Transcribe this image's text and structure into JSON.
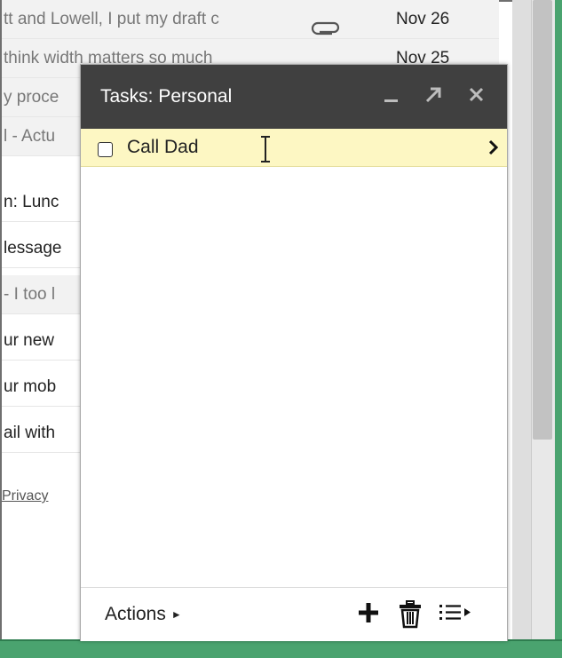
{
  "inbox": {
    "rows": [
      {
        "text": "tt and Lowell, I put my draft c",
        "date": "Nov 26",
        "attachment": true,
        "style": "read"
      },
      {
        "text": "think width matters so much",
        "date": "Nov 25",
        "attachment": false,
        "style": "read"
      },
      {
        "text": "y proce",
        "date": "",
        "attachment": false,
        "style": "read"
      },
      {
        "text": "l - Actu",
        "date": "",
        "attachment": false,
        "style": "read"
      },
      {
        "text": "n: Lunc",
        "date": "",
        "attachment": false,
        "style": "unread"
      },
      {
        "text": "lessage",
        "date": "",
        "attachment": false,
        "style": "unread"
      },
      {
        "text": "- I too l",
        "date": "",
        "attachment": false,
        "style": "read"
      },
      {
        "text": "ur new",
        "date": "",
        "attachment": false,
        "style": "unread"
      },
      {
        "text": "ur mob",
        "date": "",
        "attachment": false,
        "style": "unread"
      },
      {
        "text": "ail with",
        "date": "",
        "attachment": false,
        "style": "unread"
      }
    ],
    "privacy_link": "Privacy"
  },
  "tasks": {
    "title": "Tasks: Personal",
    "items": [
      {
        "label": "Call Dad",
        "checked": false
      }
    ],
    "footer": {
      "actions_label": "Actions"
    }
  },
  "icons": {
    "minimize": "minimize-icon",
    "popout": "popout-icon",
    "close": "close-icon",
    "attachment": "paperclip-icon",
    "chevron": "chevron-right-icon",
    "add": "plus-icon",
    "delete": "trash-icon",
    "lists": "list-icon",
    "cursor": "text-cursor-icon"
  },
  "colors": {
    "titlebar": "#404040",
    "task_highlight": "#fdf7c3",
    "frame_green": "#4aa36f"
  }
}
